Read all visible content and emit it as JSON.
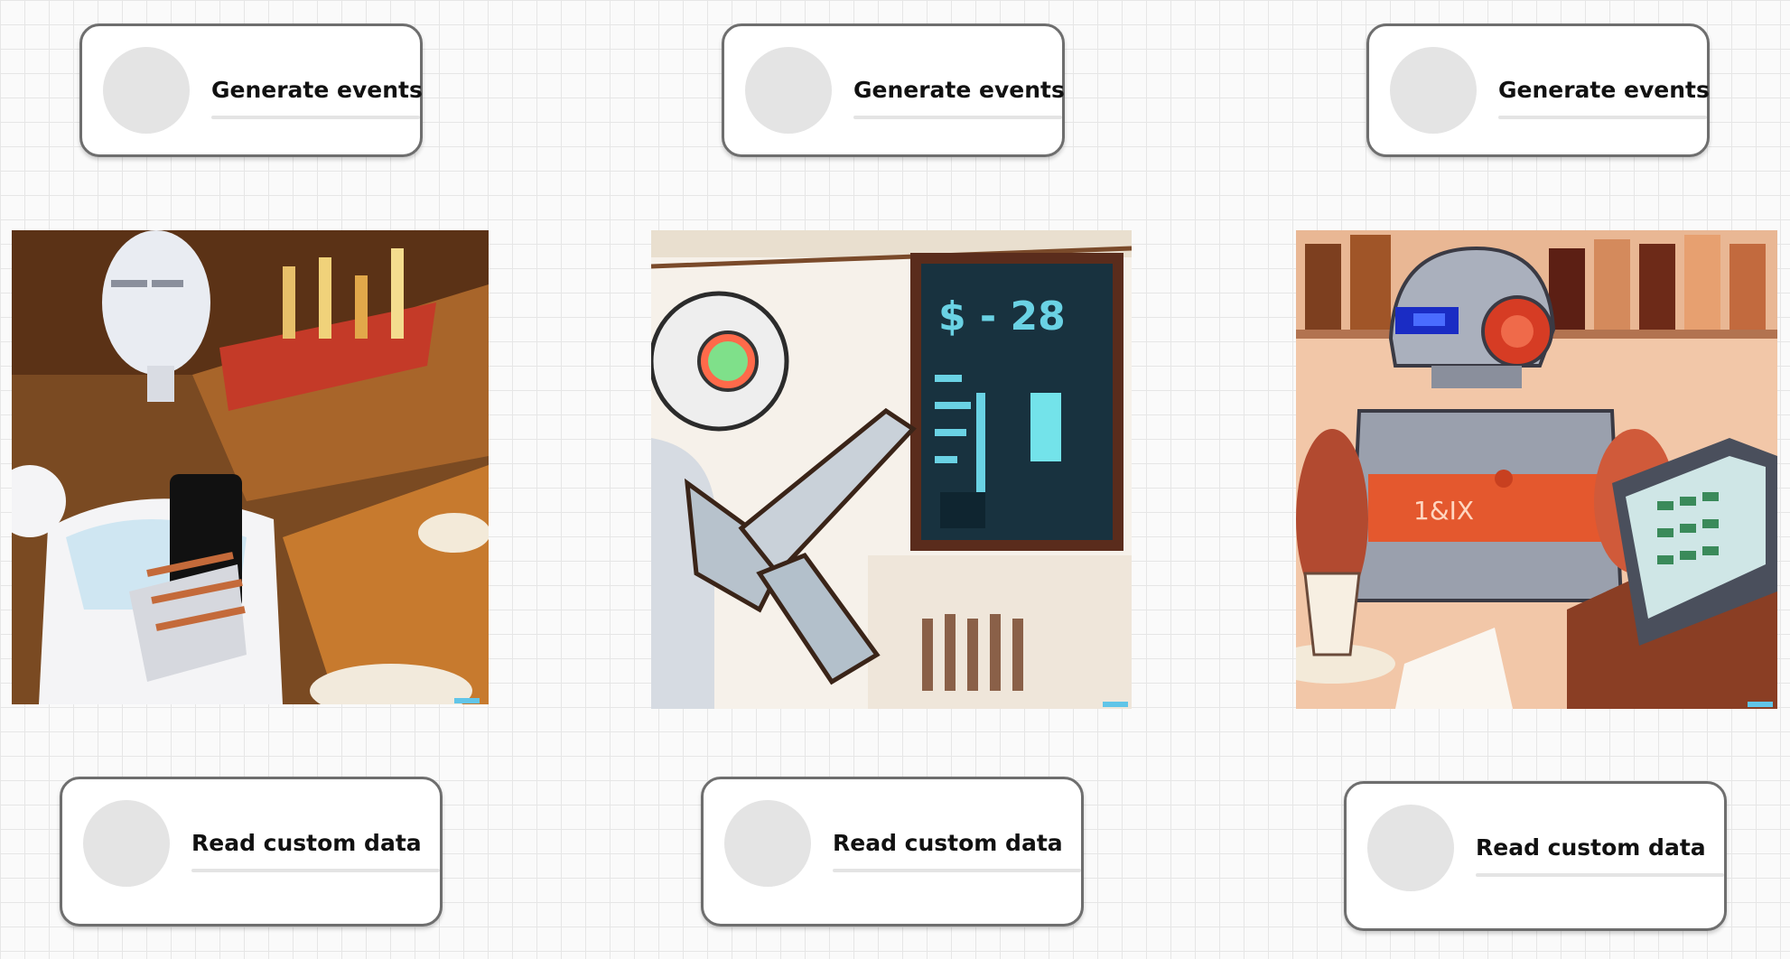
{
  "cards": {
    "top": [
      {
        "label": "Generate events"
      },
      {
        "label": "Generate events"
      },
      {
        "label": "Generate events"
      }
    ],
    "bottom": [
      {
        "label": "Read custom data"
      },
      {
        "label": "Read custom data"
      },
      {
        "label": "Read custom data"
      }
    ]
  },
  "images": [
    {
      "subject": "robot-holding-phone-at-bar"
    },
    {
      "subject": "robot-at-menu-screen"
    },
    {
      "subject": "robot-at-register-with-bottles"
    }
  ],
  "artwork_text": {
    "screen_price": "$ - 28",
    "robot_chest": "1&IX"
  },
  "colors": {
    "card_border": "#6e6e6e",
    "avatar_fill": "#e4e4e4",
    "canvas": "#fafafa",
    "grid_line": "#e6e6e6"
  }
}
